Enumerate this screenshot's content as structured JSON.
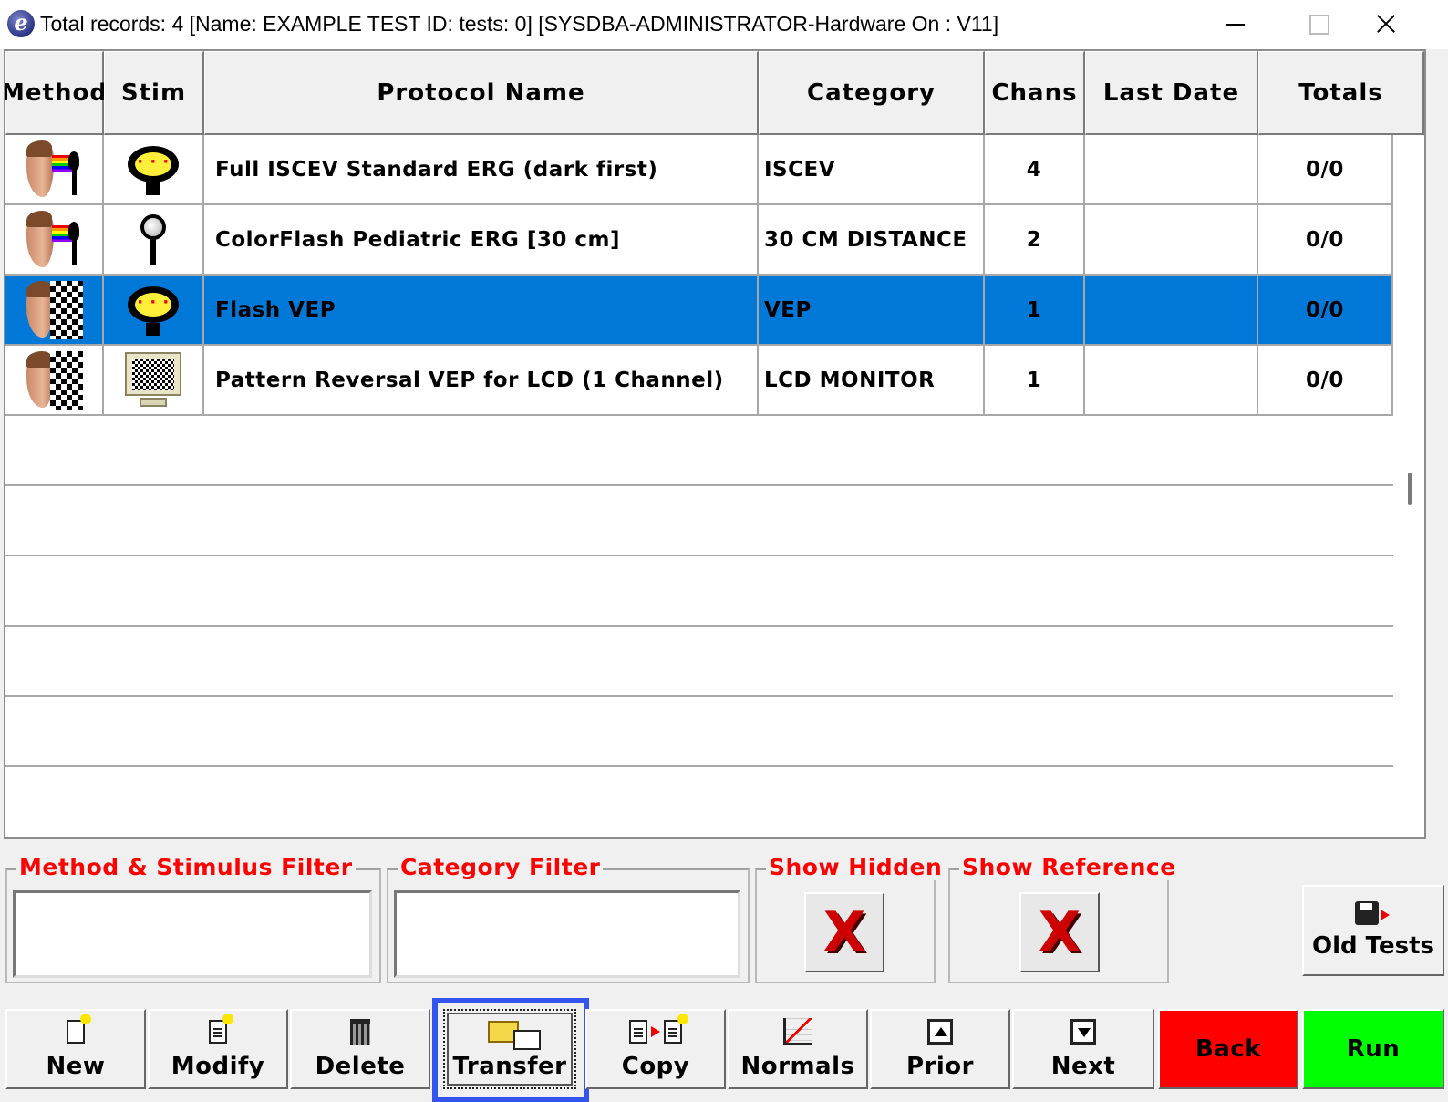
{
  "window": {
    "title": "Total records: 4  [Name: EXAMPLE TEST ID:  tests: 0] [SYSDBA-ADMINISTRATOR-Hardware On : V11]",
    "app_icon": "e"
  },
  "table": {
    "columns": [
      "Method",
      "Stim",
      "Protocol Name",
      "Category",
      "Chans",
      "Last Date",
      "Totals"
    ],
    "rows": [
      {
        "method_icon": "face-rainbow-wand-icon",
        "stim_icon": "ganzfeld-icon",
        "protocol": "Full ISCEV Standard ERG (dark first)",
        "category": "ISCEV",
        "chans": "4",
        "last_date": "",
        "totals": "0/0",
        "selected": false
      },
      {
        "method_icon": "face-rainbow-wand-icon",
        "stim_icon": "handheld-probe-icon",
        "protocol": "ColorFlash Pediatric ERG [30 cm]",
        "category": "30 CM DISTANCE",
        "chans": "2",
        "last_date": "",
        "totals": "0/0",
        "selected": false
      },
      {
        "method_icon": "face-checkerboard-icon",
        "stim_icon": "ganzfeld-icon",
        "protocol": "Flash VEP",
        "category": "VEP",
        "chans": "1",
        "last_date": "",
        "totals": "0/0",
        "selected": true
      },
      {
        "method_icon": "face-checkerboard-icon",
        "stim_icon": "lcd-monitor-icon",
        "protocol": "Pattern Reversal VEP for LCD (1 Channel)",
        "category": "LCD MONITOR",
        "chans": "1",
        "last_date": "",
        "totals": "0/0",
        "selected": false
      }
    ]
  },
  "filters": {
    "method_stimulus": {
      "label": "Method & Stimulus Filter",
      "value": ""
    },
    "category": {
      "label": "Category Filter",
      "value": ""
    },
    "show_hidden": {
      "label": "Show Hidden",
      "state": "X"
    },
    "show_reference": {
      "label": "Show Reference",
      "state": "X"
    }
  },
  "old_tests": {
    "label": "Old Tests"
  },
  "toolbar": {
    "new": "New",
    "modify": "Modify",
    "delete": "Delete",
    "transfer": "Transfer",
    "copy": "Copy",
    "normals": "Normals",
    "prior": "Prior",
    "next": "Next",
    "back": "Back",
    "run": "Run"
  },
  "colors": {
    "selection": "#0078d7",
    "filter_label": "#ff0000",
    "back_button": "#ff0000",
    "run_button": "#00ff00",
    "focus_highlight": "#3355ee"
  }
}
